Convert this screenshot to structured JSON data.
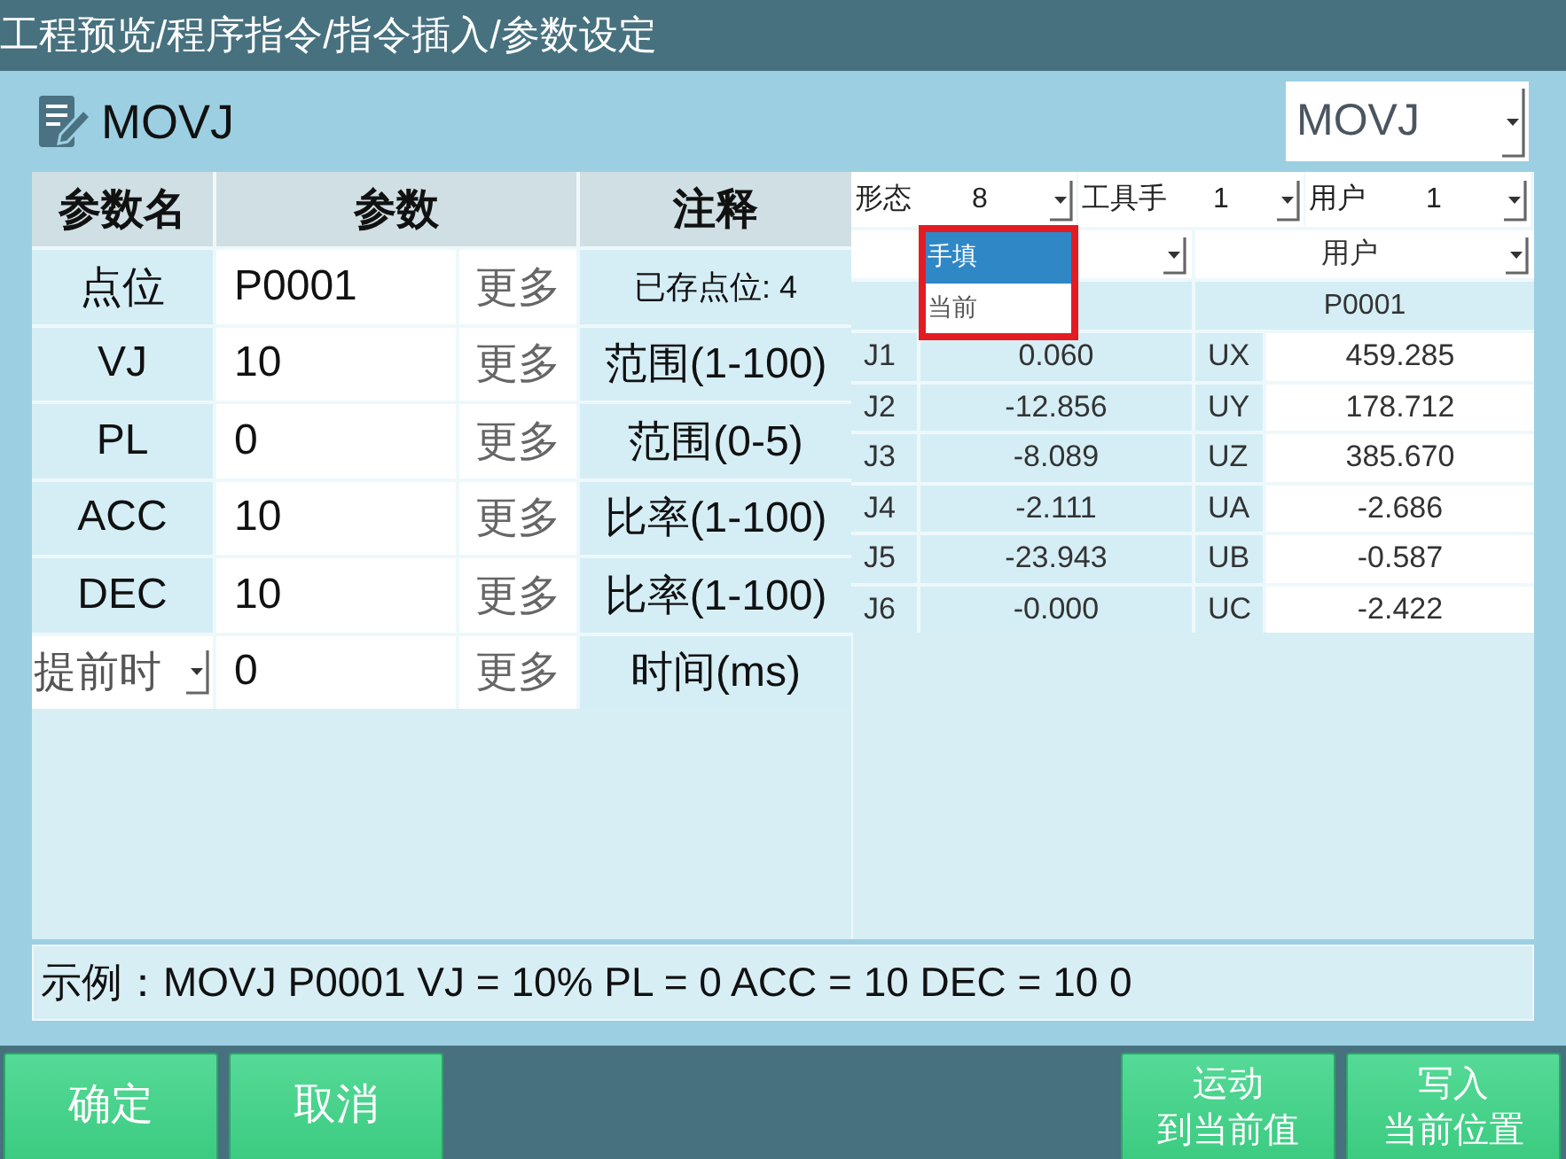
{
  "window": {
    "title": "工程预览/程序指令/指令插入/参数设定"
  },
  "header": {
    "command": "MOVJ",
    "command_select": {
      "value": "MOVJ"
    }
  },
  "param_table": {
    "columns": [
      "参数名",
      "参数",
      "注释"
    ],
    "rows": [
      {
        "kind": "point",
        "name": "点位",
        "value": "P0001",
        "more": "更多",
        "note": "已存点位: 4"
      },
      {
        "kind": "number",
        "name": "VJ",
        "value": "10",
        "more": "更多",
        "note": "范围(1-100)"
      },
      {
        "kind": "number",
        "name": "PL",
        "value": "0",
        "more": "更多",
        "note": "范围(0-5)"
      },
      {
        "kind": "number",
        "name": "ACC",
        "value": "10",
        "more": "更多",
        "note": "比率(1-100)"
      },
      {
        "kind": "number",
        "name": "DEC",
        "value": "10",
        "more": "更多",
        "note": "比率(1-100)"
      },
      {
        "kind": "select",
        "name": "提前时",
        "value": "0",
        "more": "更多",
        "note": "时间(ms)"
      }
    ]
  },
  "pose_panel": {
    "selects": [
      {
        "label": "形态",
        "value": "8"
      },
      {
        "label": "工具手",
        "value": "1"
      },
      {
        "label": "用户",
        "value": "1"
      }
    ],
    "source_select": {
      "expanded": true,
      "highlighted": true,
      "options": [
        {
          "label": "手填",
          "selected": true
        },
        {
          "label": "当前",
          "selected": false
        }
      ]
    },
    "frame_select": {
      "value": "用户"
    },
    "point_header": "P0001",
    "rows": [
      {
        "joint": "J1",
        "joint_value": "0.060",
        "axis": "UX",
        "axis_value": "459.285"
      },
      {
        "joint": "J2",
        "joint_value": "-12.856",
        "axis": "UY",
        "axis_value": "178.712"
      },
      {
        "joint": "J3",
        "joint_value": "-8.089",
        "axis": "UZ",
        "axis_value": "385.670"
      },
      {
        "joint": "J4",
        "joint_value": "-2.111",
        "axis": "UA",
        "axis_value": "-2.686"
      },
      {
        "joint": "J5",
        "joint_value": "-23.943",
        "axis": "UB",
        "axis_value": "-0.587"
      },
      {
        "joint": "J6",
        "joint_value": "-0.000",
        "axis": "UC",
        "axis_value": "-2.422"
      }
    ]
  },
  "example": "示例：MOVJ P0001 VJ = 10% PL = 0 ACC = 10 DEC = 10 0",
  "actions": {
    "left": [
      {
        "lines": [
          "确定"
        ]
      },
      {
        "lines": [
          "取消"
        ]
      }
    ],
    "right": [
      {
        "lines": [
          "运动",
          "到当前值"
        ]
      },
      {
        "lines": [
          "写入",
          "当前位置"
        ]
      }
    ]
  }
}
